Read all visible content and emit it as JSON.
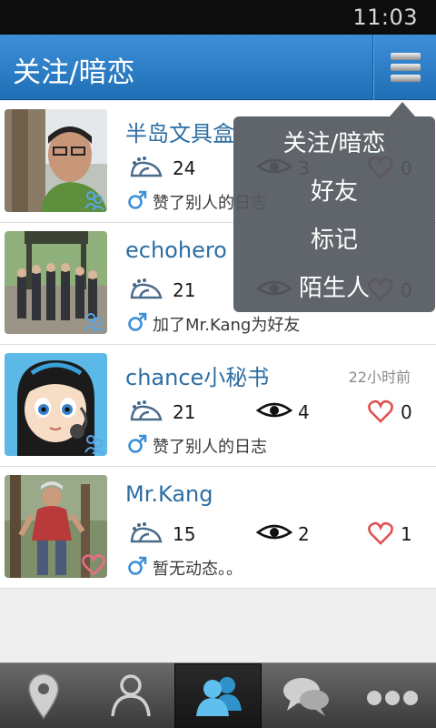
{
  "status_bar": {
    "time": "11:03"
  },
  "header": {
    "title": "关注/暗恋",
    "menu_icon": "list-menu-icon"
  },
  "dropdown_menu": {
    "items": [
      "关注/暗恋",
      "好友",
      "标记",
      "陌生人"
    ]
  },
  "contacts": [
    {
      "name": "半岛文具盒",
      "time": "",
      "footprints": "24",
      "views": "3",
      "likes": "0",
      "gender": "male",
      "activity": "赞了别人的日志"
    },
    {
      "name": "echohero",
      "time": "",
      "footprints": "21",
      "views": "",
      "likes": "0",
      "gender": "male",
      "activity": "加了Mr.Kang为好友"
    },
    {
      "name": "chance小秘书",
      "time": "22小时前",
      "footprints": "21",
      "views": "4",
      "likes": "0",
      "gender": "male",
      "activity": "赞了别人的日志"
    },
    {
      "name": "Mr.Kang",
      "time": "",
      "footprints": "15",
      "views": "2",
      "likes": "1",
      "gender": "male",
      "activity": "暂无动态。。"
    }
  ],
  "tab_bar": {
    "tabs": [
      {
        "icon": "location-pin-icon",
        "active": false
      },
      {
        "icon": "person-icon",
        "active": false
      },
      {
        "icon": "contacts-icon",
        "active": true
      },
      {
        "icon": "chat-bubbles-icon",
        "active": false
      },
      {
        "icon": "more-dots-icon",
        "active": false
      }
    ]
  },
  "colors": {
    "header": "#2b7fc6",
    "accent": "#2c6ea3",
    "heart": "#e0504f",
    "gender": "#3d8fd8"
  }
}
